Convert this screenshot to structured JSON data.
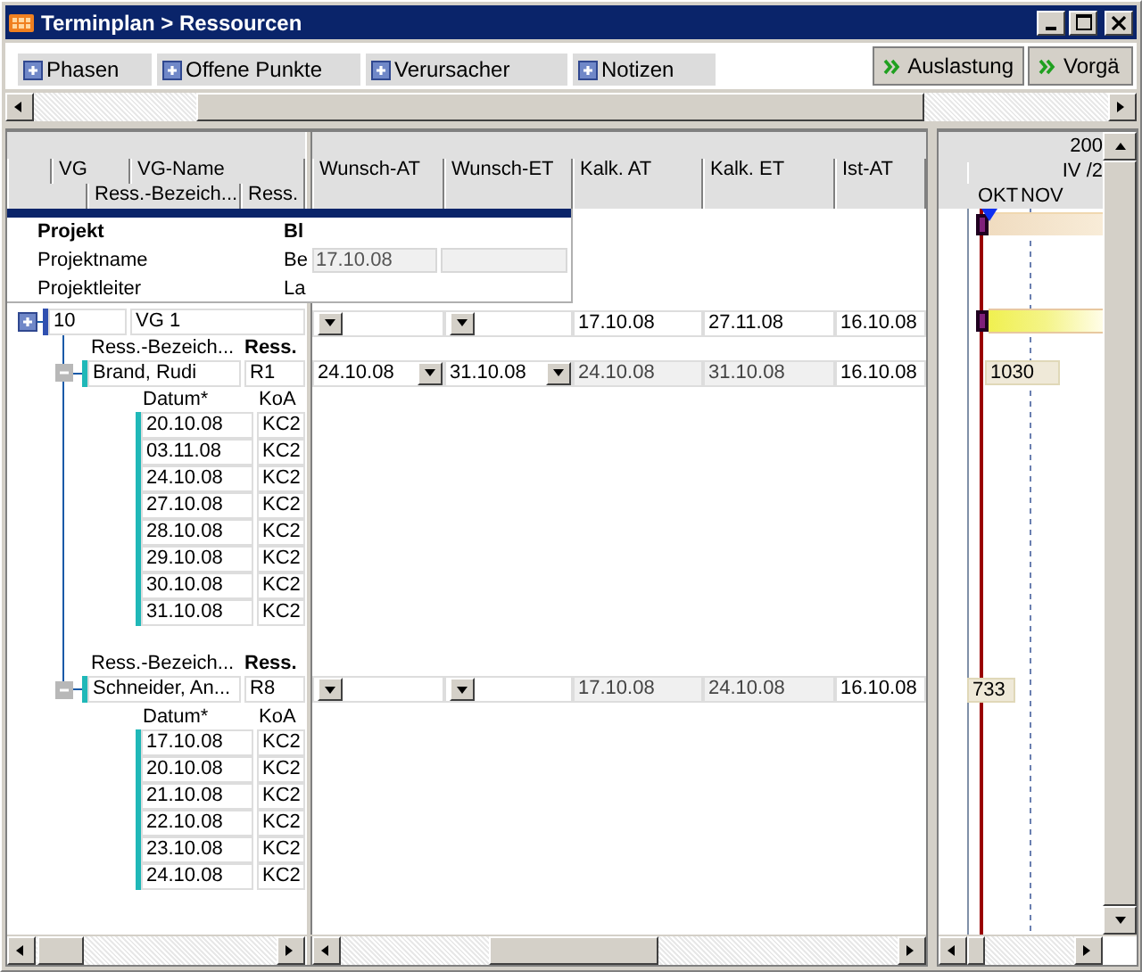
{
  "window": {
    "title": "Terminplan > Ressourcen"
  },
  "tabs": [
    {
      "label": "Phasen"
    },
    {
      "label": "Offene Punkte"
    },
    {
      "label": "Verursacher"
    },
    {
      "label": "Notizen"
    }
  ],
  "buttons": [
    {
      "label": "Auslastung"
    },
    {
      "label": "Vorgä"
    }
  ],
  "grid": {
    "columns_level1": [
      "VG",
      "VG-Name"
    ],
    "columns_level2": [
      "Ress.-Bezeich...",
      "Ress."
    ],
    "date_columns": [
      "Wunsch-AT",
      "Wunsch-ET",
      "Kalk. AT",
      "Kalk. ET",
      "Ist-AT"
    ]
  },
  "project": {
    "heading": "Projekt",
    "heading_value": "Bl",
    "rows": [
      {
        "label": "Projektname",
        "value": "Be",
        "date": "17.10.08"
      },
      {
        "label": "Projektleiter",
        "value": "La"
      }
    ]
  },
  "phases": [
    {
      "vg": "10",
      "name": "VG 1",
      "kalk_at": "17.10.08",
      "kalk_et": "27.11.08",
      "ist_at": "16.10.08",
      "resources": [
        {
          "label_1": "Ress.-Bezeich...",
          "label_2": "Ress.",
          "name": "Brand, Rudi",
          "code": "R1",
          "wunsch_at": "24.10.08",
          "wunsch_et": "31.10.08",
          "kalk_at": "24.10.08",
          "kalk_et": "31.10.08",
          "ist_at": "16.10.08",
          "load": "1030",
          "entry_headers": [
            "Datum*",
            "KoA"
          ],
          "entries": [
            {
              "date": "20.10.08",
              "koa": "KC2"
            },
            {
              "date": "03.11.08",
              "koa": "KC2"
            },
            {
              "date": "24.10.08",
              "koa": "KC2"
            },
            {
              "date": "27.10.08",
              "koa": "KC2"
            },
            {
              "date": "28.10.08",
              "koa": "KC2"
            },
            {
              "date": "29.10.08",
              "koa": "KC2"
            },
            {
              "date": "30.10.08",
              "koa": "KC2"
            },
            {
              "date": "31.10.08",
              "koa": "KC2"
            }
          ]
        },
        {
          "label_1": "Ress.-Bezeich...",
          "label_2": "Ress.",
          "name": "Schneider, An...",
          "code": "R8",
          "kalk_at": "17.10.08",
          "kalk_et": "24.10.08",
          "ist_at": "16.10.08",
          "load": "733",
          "entry_headers": [
            "Datum*",
            "KoA"
          ],
          "entries": [
            {
              "date": "17.10.08",
              "koa": "KC2"
            },
            {
              "date": "20.10.08",
              "koa": "KC2"
            },
            {
              "date": "21.10.08",
              "koa": "KC2"
            },
            {
              "date": "22.10.08",
              "koa": "KC2"
            },
            {
              "date": "23.10.08",
              "koa": "KC2"
            },
            {
              "date": "24.10.08",
              "koa": "KC2"
            }
          ]
        }
      ]
    }
  ],
  "gantt": {
    "year": "200",
    "quarter": "IV /2",
    "months": [
      "OKT",
      "NOV"
    ]
  }
}
